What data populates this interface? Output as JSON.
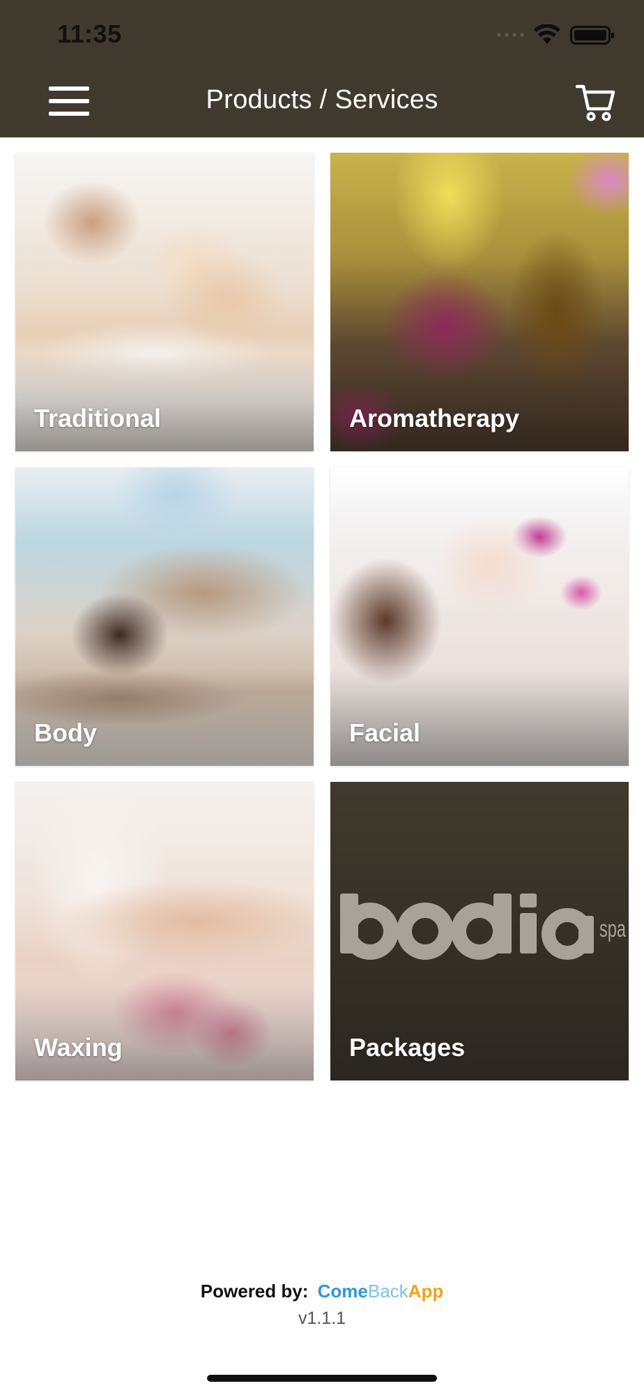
{
  "status_bar": {
    "time": "11:35",
    "icons": [
      "signal-dots-icon",
      "wifi-icon",
      "battery-icon"
    ]
  },
  "header": {
    "title": "Products / Services",
    "background": "#403a2e",
    "menu_icon": "hamburger-menu-icon",
    "cart_icon": "shopping-cart-icon"
  },
  "tiles": [
    {
      "label": "Traditional"
    },
    {
      "label": "Aromatherapy"
    },
    {
      "label": "Body"
    },
    {
      "label": "Facial"
    },
    {
      "label": "Waxing"
    },
    {
      "label": "Packages",
      "logo_text": "bodia spa"
    }
  ],
  "footer": {
    "powered_by": "Powered by:",
    "brand_come": "Come",
    "brand_back": "Back",
    "brand_app": "App",
    "version": "v1.1.1",
    "brand_colors": {
      "come": "#2a9ad4",
      "back": "#7cc3e6",
      "app": "#f2a21b"
    }
  }
}
